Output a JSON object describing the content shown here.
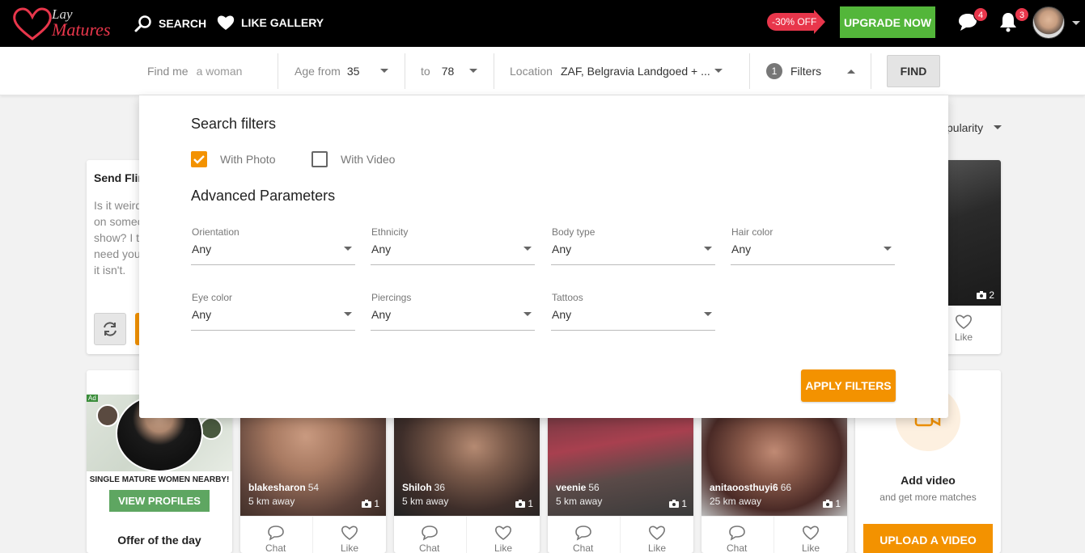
{
  "header": {
    "logo_top": "Lay",
    "logo_main": "Matures",
    "search_label": "SEARCH",
    "like_gallery_label": "LIKE GALLERY",
    "discount_label": "-30% OFF",
    "upgrade_label": "UPGRADE NOW",
    "messages_count": "4",
    "notifications_count": "3"
  },
  "searchbar": {
    "find_me_label": "Find me",
    "find_me_value": "a woman",
    "age_from_label": "Age from",
    "age_from_value": "35",
    "age_to_label": "to",
    "age_to_value": "78",
    "location_label": "Location",
    "location_value": "ZAF, Belgravia Landgoed + ...",
    "filters_count": "1",
    "filters_label": "Filters",
    "find_label": "FIND"
  },
  "background": {
    "sort_label": "pularity",
    "flirt_title": "Send Flir",
    "flirt_text_lines": [
      "Is it weird",
      "on somec",
      "show? I t",
      "need you",
      "it isn't."
    ],
    "right_card_photo_count": "2",
    "like_label": "Like",
    "chat_label": "Chat",
    "ad": {
      "tag": "Ad",
      "headline": "SINGLE MATURE WOMEN NEARBY!",
      "button": "VIEW PROFILES",
      "offer": "Offer of the day"
    },
    "profiles": [
      {
        "name": "blakesharon",
        "age": "54",
        "distance": "5 km away",
        "photos": "1"
      },
      {
        "name": "Shiloh",
        "age": "36",
        "distance": "5 km away",
        "photos": "1"
      },
      {
        "name": "veenie",
        "age": "56",
        "distance": "5 km away",
        "photos": "1"
      },
      {
        "name": "anitaoosthuyi6",
        "age": "66",
        "distance": "25 km away",
        "photos": "1"
      }
    ],
    "video": {
      "title": "Add video",
      "subtitle": "and get more matches",
      "button": "UPLOAD A VIDEO"
    }
  },
  "filter_panel": {
    "title": "Search filters",
    "with_photo_label": "With Photo",
    "with_photo_checked": true,
    "with_video_label": "With Video",
    "with_video_checked": false,
    "advanced_title": "Advanced Parameters",
    "selects": [
      {
        "label": "Orientation",
        "value": "Any"
      },
      {
        "label": "Ethnicity",
        "value": "Any"
      },
      {
        "label": "Body type",
        "value": "Any"
      },
      {
        "label": "Hair color",
        "value": "Any"
      },
      {
        "label": "Eye color",
        "value": "Any"
      },
      {
        "label": "Piercings",
        "value": "Any"
      },
      {
        "label": "Tattoos",
        "value": "Any"
      }
    ],
    "apply_label": "APPLY FILTERS"
  },
  "colors": {
    "accent_orange": "#f39200",
    "upgrade_green": "#53b63a",
    "brand_red": "#e8364b"
  }
}
